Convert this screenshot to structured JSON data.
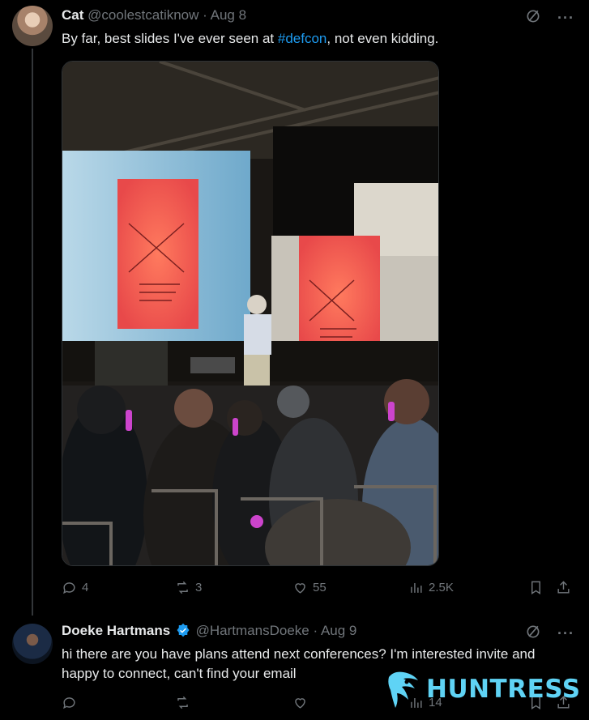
{
  "tweet1": {
    "name": "Cat",
    "handle": "@coolestcatiknow",
    "separator": "·",
    "date": "Aug 8",
    "text_before": "By far, best slides I've ever seen at ",
    "hashtag": "#defcon",
    "text_after": ", not even kidding.",
    "stats": {
      "replies": "4",
      "reposts": "3",
      "likes": "55",
      "views": "2.5K"
    }
  },
  "tweet2": {
    "name": "Doeke Hartmans",
    "handle": "@HartmansDoeke",
    "separator": "·",
    "date": "Aug 9",
    "text": "hi there are you have plans attend next conferences? I'm interested invite and happy to connect, can't find your email",
    "stats": {
      "views": "14"
    }
  },
  "watermark": {
    "brand": "HUNTRESS"
  },
  "colors": {
    "background": "#000000",
    "text": "#e7e9ea",
    "muted": "#71767b",
    "accent": "#1d9bf0",
    "brand": "#5fd3f5"
  }
}
